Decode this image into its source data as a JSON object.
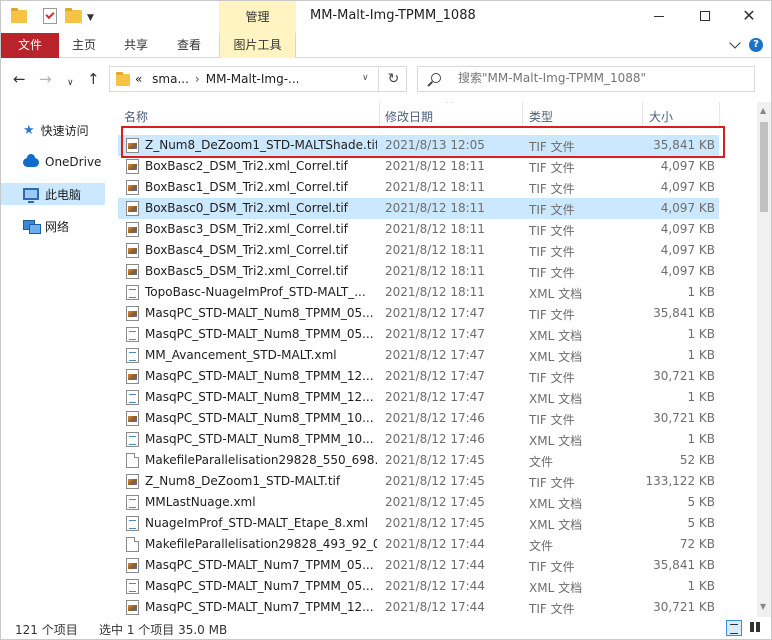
{
  "titlebar": {
    "title": "MM-Malt-Img-TPMM_1088",
    "manage_tab": "管理"
  },
  "ribbon": {
    "tabs": [
      "文件",
      "主页",
      "共享",
      "查看",
      "图片工具"
    ]
  },
  "address": {
    "overflow": "«",
    "crumb1": "sma...",
    "crumb2": "MM-Malt-Img-..."
  },
  "search": {
    "placeholder": "搜索\"MM-Malt-Img-TPMM_1088\""
  },
  "nav": {
    "items": [
      "快速访问",
      "OneDrive",
      "此电脑",
      "网络"
    ]
  },
  "columns": {
    "name": "名称",
    "date": "修改日期",
    "type": "类型",
    "size": "大小"
  },
  "files": [
    {
      "name": "Z_Num8_DeZoom1_STD-MALTShade.tif",
      "date": "2021/8/13 12:05",
      "type": "TIF 文件",
      "size": "35,841 KB",
      "icon": "tif"
    },
    {
      "name": "BoxBasc2_DSM_Tri2.xml_Correl.tif",
      "date": "2021/8/12 18:11",
      "type": "TIF 文件",
      "size": "4,097 KB",
      "icon": "tif"
    },
    {
      "name": "BoxBasc1_DSM_Tri2.xml_Correl.tif",
      "date": "2021/8/12 18:11",
      "type": "TIF 文件",
      "size": "4,097 KB",
      "icon": "tif"
    },
    {
      "name": "BoxBasc0_DSM_Tri2.xml_Correl.tif",
      "date": "2021/8/12 18:11",
      "type": "TIF 文件",
      "size": "4,097 KB",
      "icon": "tif"
    },
    {
      "name": "BoxBasc3_DSM_Tri2.xml_Correl.tif",
      "date": "2021/8/12 18:11",
      "type": "TIF 文件",
      "size": "4,097 KB",
      "icon": "tif"
    },
    {
      "name": "BoxBasc4_DSM_Tri2.xml_Correl.tif",
      "date": "2021/8/12 18:11",
      "type": "TIF 文件",
      "size": "4,097 KB",
      "icon": "tif"
    },
    {
      "name": "BoxBasc5_DSM_Tri2.xml_Correl.tif",
      "date": "2021/8/12 18:11",
      "type": "TIF 文件",
      "size": "4,097 KB",
      "icon": "tif"
    },
    {
      "name": "TopoBasc-NuageImProf_STD-MALT_...",
      "date": "2021/8/12 18:11",
      "type": "XML 文档",
      "size": "1 KB",
      "icon": "xml"
    },
    {
      "name": "MasqPC_STD-MALT_Num8_TPMM_05...",
      "date": "2021/8/12 17:47",
      "type": "TIF 文件",
      "size": "35,841 KB",
      "icon": "tif"
    },
    {
      "name": "MasqPC_STD-MALT_Num8_TPMM_05...",
      "date": "2021/8/12 17:47",
      "type": "XML 文档",
      "size": "1 KB",
      "icon": "xml"
    },
    {
      "name": "MM_Avancement_STD-MALT.xml",
      "date": "2021/8/12 17:47",
      "type": "XML 文档",
      "size": "1 KB",
      "icon": "xml"
    },
    {
      "name": "MasqPC_STD-MALT_Num8_TPMM_12...",
      "date": "2021/8/12 17:47",
      "type": "TIF 文件",
      "size": "30,721 KB",
      "icon": "tif"
    },
    {
      "name": "MasqPC_STD-MALT_Num8_TPMM_12...",
      "date": "2021/8/12 17:47",
      "type": "XML 文档",
      "size": "1 KB",
      "icon": "xml"
    },
    {
      "name": "MasqPC_STD-MALT_Num8_TPMM_10...",
      "date": "2021/8/12 17:46",
      "type": "TIF 文件",
      "size": "30,721 KB",
      "icon": "tif"
    },
    {
      "name": "MasqPC_STD-MALT_Num8_TPMM_10...",
      "date": "2021/8/12 17:46",
      "type": "XML 文档",
      "size": "1 KB",
      "icon": "xml"
    },
    {
      "name": "MakefileParallelisation29828_550_698...",
      "date": "2021/8/12 17:45",
      "type": "文件",
      "size": "52 KB",
      "icon": "file"
    },
    {
      "name": "Z_Num8_DeZoom1_STD-MALT.tif",
      "date": "2021/8/12 17:45",
      "type": "TIF 文件",
      "size": "133,122 KB",
      "icon": "tif"
    },
    {
      "name": "MMLastNuage.xml",
      "date": "2021/8/12 17:45",
      "type": "XML 文档",
      "size": "5 KB",
      "icon": "xml"
    },
    {
      "name": "NuageImProf_STD-MALT_Etape_8.xml",
      "date": "2021/8/12 17:45",
      "type": "XML 文档",
      "size": "5 KB",
      "icon": "xml"
    },
    {
      "name": "MakefileParallelisation29828_493_92_0",
      "date": "2021/8/12 17:44",
      "type": "文件",
      "size": "72 KB",
      "icon": "file"
    },
    {
      "name": "MasqPC_STD-MALT_Num7_TPMM_05...",
      "date": "2021/8/12 17:44",
      "type": "TIF 文件",
      "size": "35,841 KB",
      "icon": "tif"
    },
    {
      "name": "MasqPC_STD-MALT_Num7_TPMM_05...",
      "date": "2021/8/12 17:44",
      "type": "XML 文档",
      "size": "1 KB",
      "icon": "xml"
    },
    {
      "name": "MasqPC_STD-MALT_Num7_TPMM_12...",
      "date": "2021/8/12 17:44",
      "type": "TIF 文件",
      "size": "30,721 KB",
      "icon": "tif"
    }
  ],
  "status": {
    "count": "121 个项目",
    "selected": "选中 1 个项目  35.0 MB"
  }
}
